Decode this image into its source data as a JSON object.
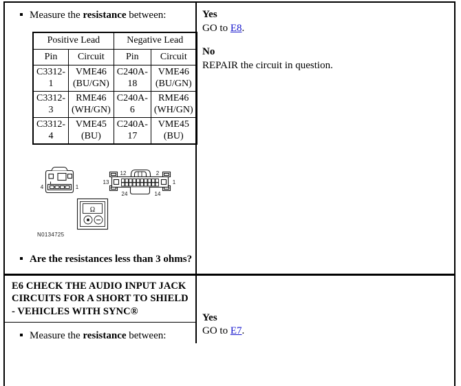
{
  "document": {
    "type": "diagnostic-procedure-table"
  },
  "steps": [
    {
      "id": "step-e5-continued",
      "header": null,
      "instruction_prefix": "Measure the ",
      "instruction_bold": "resistance",
      "instruction_suffix": " between:",
      "measurement_table": {
        "group_headers": [
          "Positive Lead",
          "Negative Lead"
        ],
        "column_headers": [
          "Pin",
          "Circuit",
          "Pin",
          "Circuit"
        ],
        "rows": [
          [
            "C3312-1",
            "VME46 (BU/GN)",
            "C240A-18",
            "VME46 (BU/GN)"
          ],
          [
            "C3312-3",
            "RME46 (WH/GN)",
            "C240A-6",
            "RME46 (WH/GN)"
          ],
          [
            "C3312-4",
            "VME45 (BU)",
            "C240A-17",
            "VME45 (BU)"
          ]
        ]
      },
      "figure": {
        "id_label": "N0134725",
        "connector_small": {
          "left_pin_label": "4",
          "right_pin_label": "1"
        },
        "connector_large": {
          "top_left_label": "12",
          "top_right_label": "2",
          "left_label": "13",
          "right_label": "1",
          "bottom_left_label": "24",
          "bottom_right_label": "14"
        },
        "meter": {
          "display_symbol": "Ω"
        }
      },
      "question": "Are the resistances less than 3 ohms?",
      "answers": [
        {
          "label": "Yes",
          "text_before": "GO to ",
          "link": "E8",
          "text_after": "."
        },
        {
          "label": "No",
          "text_before": "REPAIR the circuit in question.",
          "link": null,
          "text_after": ""
        }
      ]
    },
    {
      "id": "step-e6",
      "header": "E6 CHECK THE AUDIO INPUT JACK CIRCUITS FOR A SHORT TO SHIELD - VEHICLES WITH SYNC®",
      "instruction_prefix": "Measure the ",
      "instruction_bold": "resistance",
      "instruction_suffix": " between:",
      "answers": [
        {
          "label": "Yes",
          "text_before": "GO to ",
          "link": "E7",
          "text_after": "."
        }
      ]
    }
  ],
  "colors": {
    "border": "#000000",
    "link": "#1414cc",
    "text": "#000000",
    "background": "#ffffff"
  }
}
